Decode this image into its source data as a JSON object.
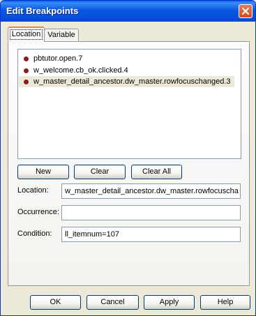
{
  "window": {
    "title": "Edit Breakpoints"
  },
  "tabs": [
    {
      "label": "Location",
      "active": true
    },
    {
      "label": "Variable",
      "active": false
    }
  ],
  "breakpoints": [
    {
      "label": "pbtutor.open.7",
      "selected": false
    },
    {
      "label": "w_welcome.cb_ok.clicked.4",
      "selected": false
    },
    {
      "label": "w_master_detail_ancestor.dw_master.rowfocuschanged.3",
      "selected": true
    }
  ],
  "list_buttons": {
    "new": "New",
    "clear": "Clear",
    "clear_all": "Clear All"
  },
  "form": {
    "location_label": "Location:",
    "location_value": "w_master_detail_ancestor.dw_master.rowfocuscha",
    "occurrence_label": "Occurrence:",
    "occurrence_value": "",
    "condition_label": "Condition:",
    "condition_value": "ll_itemnum=107"
  },
  "dialog_buttons": {
    "ok": "OK",
    "cancel": "Cancel",
    "apply": "Apply",
    "help": "Help"
  },
  "colors": {
    "titlebar": "#0a57e0",
    "breakpoint_dot": "#8b1a1a",
    "dialog_bg": "#ece9d8"
  },
  "icons": {
    "close": "close-icon",
    "breakpoint": "breakpoint-icon"
  }
}
